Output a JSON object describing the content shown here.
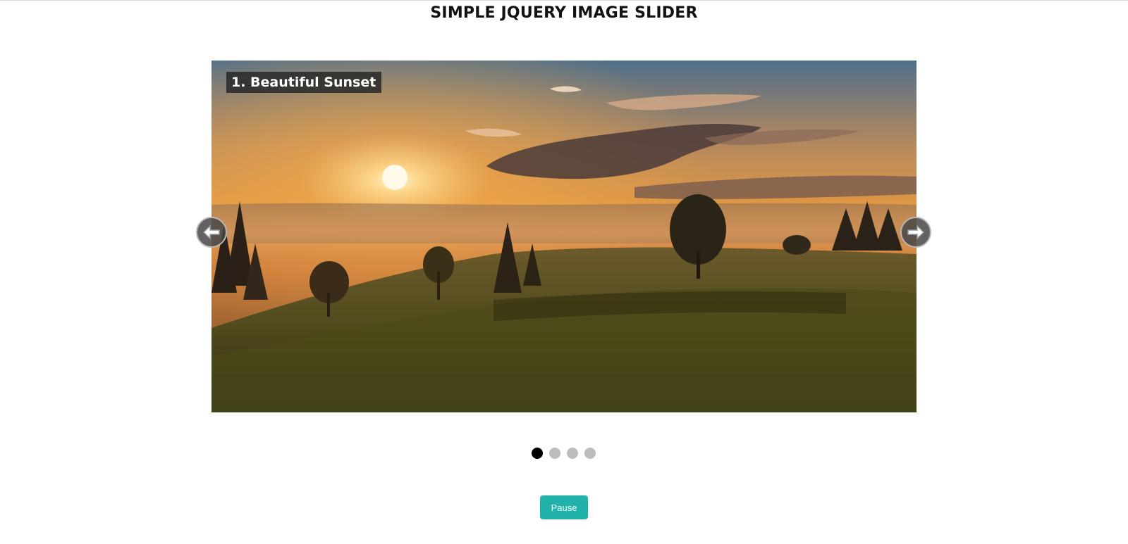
{
  "page": {
    "title": "SIMPLE JQUERY IMAGE SLIDER"
  },
  "slider": {
    "caption": "1. Beautiful Sunset",
    "image_icon": "sunset-landscape-photo",
    "prev_icon": "arrow-left-icon",
    "next_icon": "arrow-right-icon",
    "dots": [
      {
        "active": true
      },
      {
        "active": false
      },
      {
        "active": false
      },
      {
        "active": false
      }
    ],
    "active_index": 0
  },
  "controls": {
    "pause_label": "Pause"
  },
  "colors": {
    "accent": "#20b2aa",
    "dot_active": "#000000",
    "dot_inactive": "#bdbdbd"
  }
}
